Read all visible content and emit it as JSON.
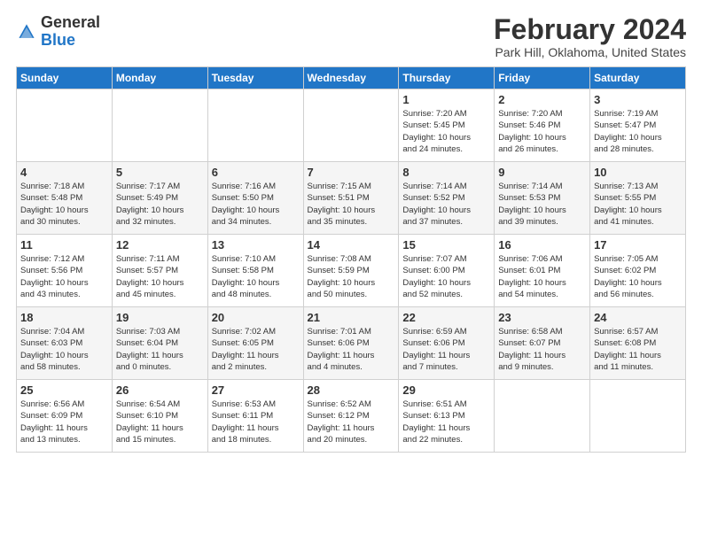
{
  "header": {
    "logo_general": "General",
    "logo_blue": "Blue",
    "month_title": "February 2024",
    "location": "Park Hill, Oklahoma, United States"
  },
  "days_of_week": [
    "Sunday",
    "Monday",
    "Tuesday",
    "Wednesday",
    "Thursday",
    "Friday",
    "Saturday"
  ],
  "weeks": [
    [
      {
        "day": "",
        "info": ""
      },
      {
        "day": "",
        "info": ""
      },
      {
        "day": "",
        "info": ""
      },
      {
        "day": "",
        "info": ""
      },
      {
        "day": "1",
        "info": "Sunrise: 7:20 AM\nSunset: 5:45 PM\nDaylight: 10 hours\nand 24 minutes."
      },
      {
        "day": "2",
        "info": "Sunrise: 7:20 AM\nSunset: 5:46 PM\nDaylight: 10 hours\nand 26 minutes."
      },
      {
        "day": "3",
        "info": "Sunrise: 7:19 AM\nSunset: 5:47 PM\nDaylight: 10 hours\nand 28 minutes."
      }
    ],
    [
      {
        "day": "4",
        "info": "Sunrise: 7:18 AM\nSunset: 5:48 PM\nDaylight: 10 hours\nand 30 minutes."
      },
      {
        "day": "5",
        "info": "Sunrise: 7:17 AM\nSunset: 5:49 PM\nDaylight: 10 hours\nand 32 minutes."
      },
      {
        "day": "6",
        "info": "Sunrise: 7:16 AM\nSunset: 5:50 PM\nDaylight: 10 hours\nand 34 minutes."
      },
      {
        "day": "7",
        "info": "Sunrise: 7:15 AM\nSunset: 5:51 PM\nDaylight: 10 hours\nand 35 minutes."
      },
      {
        "day": "8",
        "info": "Sunrise: 7:14 AM\nSunset: 5:52 PM\nDaylight: 10 hours\nand 37 minutes."
      },
      {
        "day": "9",
        "info": "Sunrise: 7:14 AM\nSunset: 5:53 PM\nDaylight: 10 hours\nand 39 minutes."
      },
      {
        "day": "10",
        "info": "Sunrise: 7:13 AM\nSunset: 5:55 PM\nDaylight: 10 hours\nand 41 minutes."
      }
    ],
    [
      {
        "day": "11",
        "info": "Sunrise: 7:12 AM\nSunset: 5:56 PM\nDaylight: 10 hours\nand 43 minutes."
      },
      {
        "day": "12",
        "info": "Sunrise: 7:11 AM\nSunset: 5:57 PM\nDaylight: 10 hours\nand 45 minutes."
      },
      {
        "day": "13",
        "info": "Sunrise: 7:10 AM\nSunset: 5:58 PM\nDaylight: 10 hours\nand 48 minutes."
      },
      {
        "day": "14",
        "info": "Sunrise: 7:08 AM\nSunset: 5:59 PM\nDaylight: 10 hours\nand 50 minutes."
      },
      {
        "day": "15",
        "info": "Sunrise: 7:07 AM\nSunset: 6:00 PM\nDaylight: 10 hours\nand 52 minutes."
      },
      {
        "day": "16",
        "info": "Sunrise: 7:06 AM\nSunset: 6:01 PM\nDaylight: 10 hours\nand 54 minutes."
      },
      {
        "day": "17",
        "info": "Sunrise: 7:05 AM\nSunset: 6:02 PM\nDaylight: 10 hours\nand 56 minutes."
      }
    ],
    [
      {
        "day": "18",
        "info": "Sunrise: 7:04 AM\nSunset: 6:03 PM\nDaylight: 10 hours\nand 58 minutes."
      },
      {
        "day": "19",
        "info": "Sunrise: 7:03 AM\nSunset: 6:04 PM\nDaylight: 11 hours\nand 0 minutes."
      },
      {
        "day": "20",
        "info": "Sunrise: 7:02 AM\nSunset: 6:05 PM\nDaylight: 11 hours\nand 2 minutes."
      },
      {
        "day": "21",
        "info": "Sunrise: 7:01 AM\nSunset: 6:06 PM\nDaylight: 11 hours\nand 4 minutes."
      },
      {
        "day": "22",
        "info": "Sunrise: 6:59 AM\nSunset: 6:06 PM\nDaylight: 11 hours\nand 7 minutes."
      },
      {
        "day": "23",
        "info": "Sunrise: 6:58 AM\nSunset: 6:07 PM\nDaylight: 11 hours\nand 9 minutes."
      },
      {
        "day": "24",
        "info": "Sunrise: 6:57 AM\nSunset: 6:08 PM\nDaylight: 11 hours\nand 11 minutes."
      }
    ],
    [
      {
        "day": "25",
        "info": "Sunrise: 6:56 AM\nSunset: 6:09 PM\nDaylight: 11 hours\nand 13 minutes."
      },
      {
        "day": "26",
        "info": "Sunrise: 6:54 AM\nSunset: 6:10 PM\nDaylight: 11 hours\nand 15 minutes."
      },
      {
        "day": "27",
        "info": "Sunrise: 6:53 AM\nSunset: 6:11 PM\nDaylight: 11 hours\nand 18 minutes."
      },
      {
        "day": "28",
        "info": "Sunrise: 6:52 AM\nSunset: 6:12 PM\nDaylight: 11 hours\nand 20 minutes."
      },
      {
        "day": "29",
        "info": "Sunrise: 6:51 AM\nSunset: 6:13 PM\nDaylight: 11 hours\nand 22 minutes."
      },
      {
        "day": "",
        "info": ""
      },
      {
        "day": "",
        "info": ""
      }
    ]
  ]
}
